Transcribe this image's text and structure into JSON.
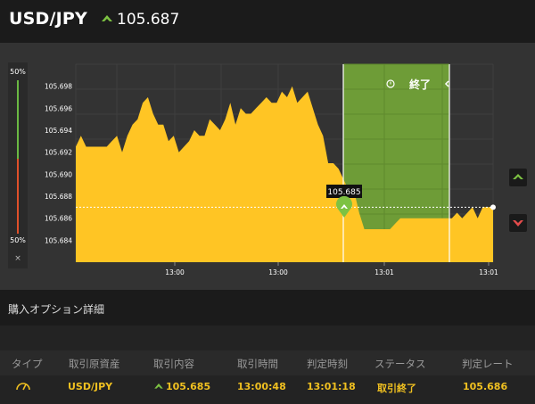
{
  "header": {
    "pair": "USD/JPY",
    "price": "105.687",
    "direction_icon": "up-arrow-icon",
    "color_up": "#7dc242"
  },
  "ratio": {
    "top": "50%",
    "bottom": "50%",
    "close_label": "×",
    "color_high": "#6ab843",
    "color_low": "#e0502a"
  },
  "chart": {
    "end_label": "終了",
    "end_icon": "clock-icon",
    "entry_label": "105.685",
    "x_ticks": [
      "13:00",
      "13:00",
      "13:01",
      "13:01"
    ],
    "y_ticks": [
      "105.698",
      "105.696",
      "105.694",
      "105.692",
      "105.690",
      "105.688",
      "105.686",
      "105.684"
    ],
    "colors": {
      "area": "#ffc524",
      "window": "#6e9c37",
      "background": "#333333"
    }
  },
  "chart_data": {
    "type": "area",
    "y_tick_labels": [
      "105.698",
      "105.696",
      "105.694",
      "105.692",
      "105.690",
      "105.688",
      "105.686",
      "105.684"
    ],
    "x_tick_labels": [
      "13:00",
      "13:00",
      "13:01",
      "13:01"
    ],
    "ylim": [
      105.682,
      105.7
    ],
    "series": [
      {
        "values": [
          105.6925,
          105.6935,
          105.6925,
          105.6925,
          105.6925,
          105.6925,
          105.6925,
          105.693,
          105.6935,
          105.692,
          105.6935,
          105.6945,
          105.695,
          105.6965,
          105.697,
          105.6955,
          105.6945,
          105.6945,
          105.693,
          105.6935,
          105.692,
          105.6925,
          105.693,
          105.694,
          105.6935,
          105.6935,
          105.695,
          105.6945,
          105.694,
          105.695,
          105.6965,
          105.6945,
          105.696,
          105.6955,
          105.6955,
          105.696,
          105.6965,
          105.697,
          105.6965,
          105.6965,
          105.6975,
          105.697,
          105.698,
          105.6965,
          105.697,
          105.6975,
          105.696,
          105.6945,
          105.6935,
          105.691,
          105.691,
          105.6905,
          105.6895,
          105.6885,
          105.6885,
          105.6865,
          105.685,
          105.685,
          105.685,
          105.685,
          105.685,
          105.685,
          105.6855,
          105.686,
          105.686,
          105.686,
          105.686,
          105.686,
          105.686,
          105.686,
          105.686,
          105.686,
          105.686,
          105.686,
          105.6865,
          105.686,
          105.6865,
          105.687,
          105.686,
          105.687,
          105.687,
          105.687
        ]
      }
    ],
    "entry_rate": 105.685,
    "current_rate": 105.687
  },
  "side_buttons": {
    "up_icon": "up-arrow-icon",
    "down_icon": "down-arrow-icon"
  },
  "section": {
    "title": "購入オプション詳細"
  },
  "table": {
    "headers": [
      "タイプ",
      "取引原資産",
      "取引内容",
      "取引時間",
      "判定時刻",
      "ステータス",
      "判定レート"
    ],
    "row": {
      "type_icon": "gauge-icon",
      "asset": "USD/JPY",
      "content": "105.685",
      "content_icon": "up-arrow-icon",
      "trade_time": "13:00:48",
      "judge_time": "13:01:18",
      "status": "取引終了",
      "rate": "105.686"
    },
    "value_color": "#f0c020"
  }
}
